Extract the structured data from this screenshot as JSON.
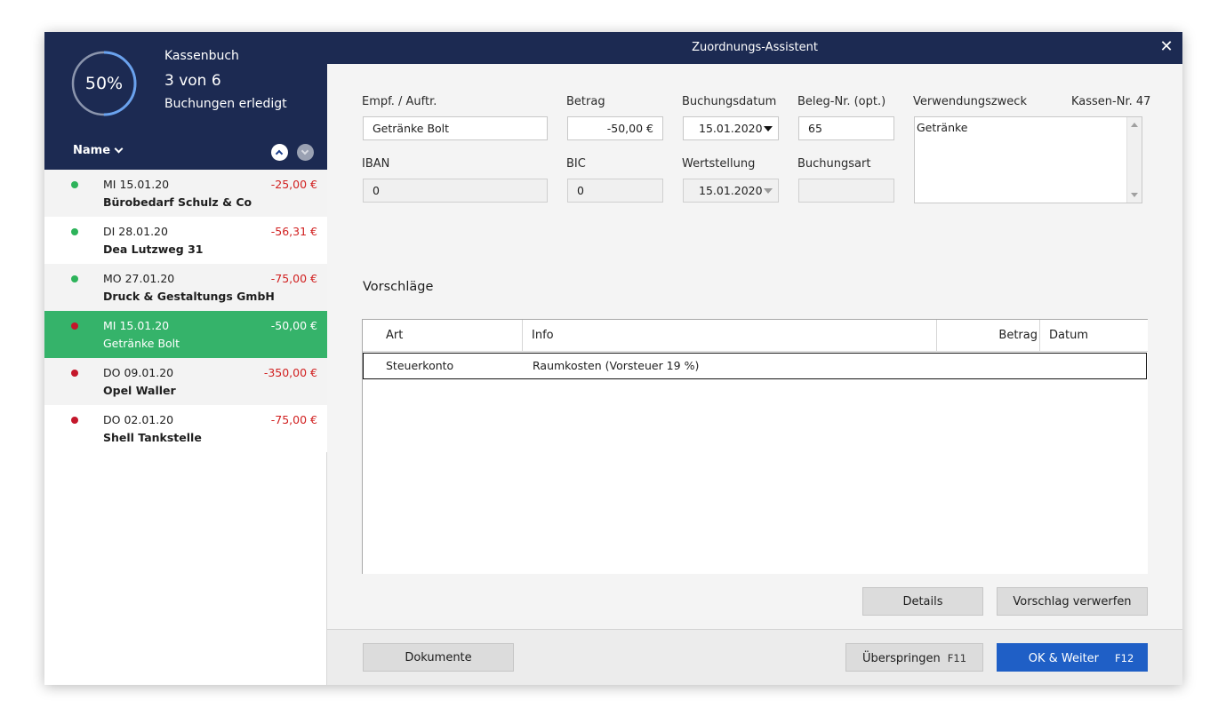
{
  "sidebar": {
    "progress_percent": 50,
    "progress_label": "50%",
    "title": "Kassenbuch",
    "count": "3 von 6",
    "subtitle": "Buchungen erledigt",
    "sort_label": "Name",
    "items": [
      {
        "date": "MI 15.01.20",
        "name": "Bürobedarf Schulz & Co",
        "amount": "-25,00 €",
        "status": "green",
        "selected": false
      },
      {
        "date": "DI 28.01.20",
        "name": "Dea Lutzweg 31",
        "amount": "-56,31 €",
        "status": "green",
        "selected": false
      },
      {
        "date": "MO 27.01.20",
        "name": "Druck & Gestaltungs GmbH",
        "amount": "-75,00 €",
        "status": "green",
        "selected": false
      },
      {
        "date": "MI 15.01.20",
        "name": "Getränke Bolt",
        "amount": "-50,00 €",
        "status": "red",
        "selected": true
      },
      {
        "date": "DO 09.01.20",
        "name": "Opel Waller",
        "amount": "-350,00 €",
        "status": "red",
        "selected": false
      },
      {
        "date": "DO 02.01.20",
        "name": "Shell Tankstelle",
        "amount": "-75,00 €",
        "status": "red",
        "selected": false
      }
    ]
  },
  "window": {
    "title": "Zuordnungs-Assistent",
    "close": "✕"
  },
  "form": {
    "recipient_label": "Empf. / Auftr.",
    "recipient_value": "Getränke Bolt",
    "amount_label": "Betrag",
    "amount_value": "-50,00 €",
    "booking_date_label": "Buchungsdatum",
    "booking_date_value": "15.01.2020",
    "receipt_label": "Beleg-Nr. (opt.)",
    "receipt_value": "65",
    "purpose_label": "Verwendungszweck",
    "cash_no": "Kassen-Nr. 47",
    "purpose_value": "Getränke",
    "iban_label": "IBAN",
    "iban_value": "0",
    "bic_label": "BIC",
    "bic_value": "0",
    "value_date_label": "Wertstellung",
    "value_date_value": "15.01.2020",
    "booking_type_label": "Buchungsart",
    "booking_type_value": ""
  },
  "suggestions": {
    "title": "Vorschläge",
    "columns": {
      "art": "Art",
      "info": "Info",
      "betrag": "Betrag",
      "datum": "Datum"
    },
    "rows": [
      {
        "art": "Steuerkonto",
        "info": "Raumkosten (Vorsteuer 19 %)",
        "betrag": "",
        "datum": ""
      }
    ],
    "details_button": "Details",
    "discard_button": "Vorschlag verwerfen"
  },
  "footer": {
    "documents_button": "Dokumente",
    "skip_button": "Überspringen",
    "skip_key": "F11",
    "ok_button": "OK & Weiter",
    "ok_key": "F12"
  },
  "colors": {
    "header_bg": "#1c2a52",
    "selected_row": "#35b36a",
    "primary": "#1f5fc6",
    "negative": "#d12020"
  }
}
